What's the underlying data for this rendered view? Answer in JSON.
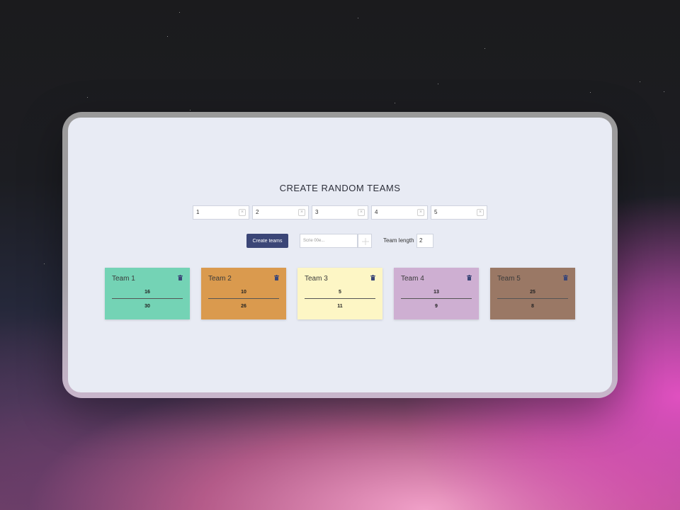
{
  "page": {
    "title": "CREATE RANDOM TEAMS"
  },
  "member_inputs": [
    {
      "value": "1",
      "clear_icon": "close-icon"
    },
    {
      "value": "2",
      "clear_icon": "close-icon"
    },
    {
      "value": "3",
      "clear_icon": "close-icon"
    },
    {
      "value": "4",
      "clear_icon": "close-icon"
    },
    {
      "value": "5",
      "clear_icon": "close-icon"
    }
  ],
  "controls": {
    "create_button_label": "Create teams",
    "name_input_placeholder": "Scrie 00e...",
    "add_icon": "plus-icon",
    "team_length_label": "Team length",
    "team_length_value": "2"
  },
  "teams": [
    {
      "name": "Team 1",
      "members": [
        "16",
        "30"
      ],
      "color": "#74d3b5",
      "icon": "trash-icon"
    },
    {
      "name": "Team 2",
      "members": [
        "10",
        "26"
      ],
      "color": "#da9a4e",
      "icon": "trash-icon"
    },
    {
      "name": "Team 3",
      "members": [
        "5",
        "11"
      ],
      "color": "#fdf6c5",
      "icon": "trash-icon"
    },
    {
      "name": "Team 4",
      "members": [
        "13",
        "9"
      ],
      "color": "#ceafd2",
      "icon": "trash-icon"
    },
    {
      "name": "Team 5",
      "members": [
        "25",
        "8"
      ],
      "color": "#9a7865",
      "icon": "trash-icon"
    }
  ],
  "colors": {
    "accent": "#3b4677",
    "panel_background": "#e8ebf4"
  }
}
